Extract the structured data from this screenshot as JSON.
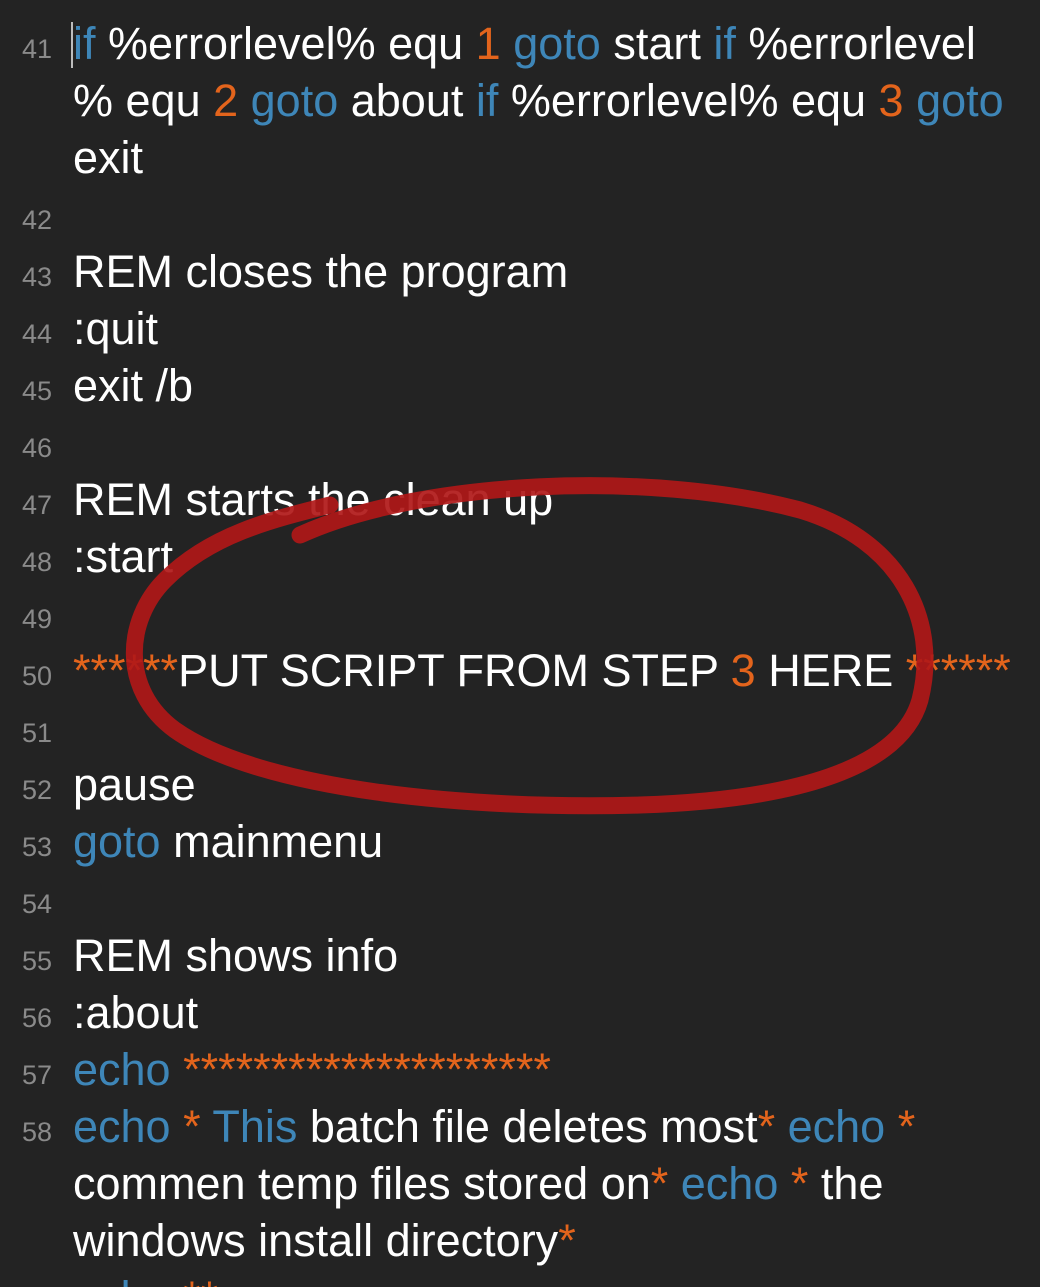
{
  "editor": {
    "lines": [
      {
        "n": "41",
        "segments": [
          [
            {
              "t": "if",
              "c": "kw"
            },
            {
              "t": " %errorlevel% equ ",
              "c": "str"
            },
            {
              "t": "1",
              "c": "num"
            },
            {
              "t": " ",
              "c": "str"
            },
            {
              "t": "goto",
              "c": "kw"
            },
            {
              "t": " start ",
              "c": "str"
            },
            {
              "t": "if",
              "c": "kw"
            },
            {
              "t": " %errorlevel",
              "c": "str"
            }
          ],
          [
            {
              "t": "% equ ",
              "c": "str"
            },
            {
              "t": "2",
              "c": "num"
            },
            {
              "t": " ",
              "c": "str"
            },
            {
              "t": "goto",
              "c": "kw"
            },
            {
              "t": " about ",
              "c": "str"
            },
            {
              "t": "if",
              "c": "kw"
            },
            {
              "t": " %errorlevel% equ ",
              "c": "str"
            },
            {
              "t": "3",
              "c": "num"
            },
            {
              "t": " ",
              "c": "str"
            },
            {
              "t": "goto",
              "c": "kw"
            }
          ],
          [
            {
              "t": "exit",
              "c": "str"
            }
          ]
        ]
      },
      {
        "n": "42",
        "segments": [
          []
        ]
      },
      {
        "n": "43",
        "segments": [
          [
            {
              "t": "REM closes the program",
              "c": "str"
            }
          ]
        ]
      },
      {
        "n": "44",
        "segments": [
          [
            {
              "t": ":quit",
              "c": "str"
            }
          ]
        ]
      },
      {
        "n": "45",
        "segments": [
          [
            {
              "t": "exit /b",
              "c": "str"
            }
          ]
        ]
      },
      {
        "n": "46",
        "segments": [
          []
        ]
      },
      {
        "n": "47",
        "segments": [
          [
            {
              "t": "REM starts the clean up",
              "c": "str"
            }
          ]
        ]
      },
      {
        "n": "48",
        "segments": [
          [
            {
              "t": ":start",
              "c": "str"
            }
          ]
        ]
      },
      {
        "n": "49",
        "segments": [
          []
        ]
      },
      {
        "n": "50",
        "segments": [
          [
            {
              "t": "******",
              "c": "num"
            },
            {
              "t": "PUT SCRIPT FROM STEP ",
              "c": "str"
            },
            {
              "t": "3",
              "c": "num"
            },
            {
              "t": " HERE ",
              "c": "str"
            },
            {
              "t": "******",
              "c": "num"
            }
          ]
        ]
      },
      {
        "n": "51",
        "segments": [
          []
        ]
      },
      {
        "n": "52",
        "segments": [
          [
            {
              "t": "pause",
              "c": "str"
            }
          ]
        ]
      },
      {
        "n": "53",
        "segments": [
          [
            {
              "t": "goto",
              "c": "kw"
            },
            {
              "t": " mainmenu",
              "c": "str"
            }
          ]
        ]
      },
      {
        "n": "54",
        "segments": [
          []
        ]
      },
      {
        "n": "55",
        "segments": [
          [
            {
              "t": "REM shows info",
              "c": "str"
            }
          ]
        ]
      },
      {
        "n": "56",
        "segments": [
          [
            {
              "t": ":about",
              "c": "str"
            }
          ]
        ]
      },
      {
        "n": "57",
        "segments": [
          [
            {
              "t": "echo",
              "c": "kw"
            },
            {
              "t": " ",
              "c": "str"
            },
            {
              "t": "*********************",
              "c": "num"
            }
          ]
        ]
      },
      {
        "n": "58",
        "segments": [
          [
            {
              "t": "echo",
              "c": "kw"
            },
            {
              "t": " ",
              "c": "str"
            },
            {
              "t": "*",
              "c": "num"
            },
            {
              "t": " ",
              "c": "str"
            },
            {
              "t": "This",
              "c": "kw"
            },
            {
              "t": " batch file deletes most",
              "c": "str"
            },
            {
              "t": "*",
              "c": "num"
            },
            {
              "t": " ",
              "c": "str"
            },
            {
              "t": "echo",
              "c": "kw"
            },
            {
              "t": " ",
              "c": "str"
            },
            {
              "t": "*",
              "c": "num"
            }
          ],
          [
            {
              "t": "commen temp files stored on",
              "c": "str"
            },
            {
              "t": "*",
              "c": "num"
            },
            {
              "t": " ",
              "c": "str"
            },
            {
              "t": "echo",
              "c": "kw"
            },
            {
              "t": " ",
              "c": "str"
            },
            {
              "t": "*",
              "c": "num"
            },
            {
              "t": " the",
              "c": "str"
            }
          ],
          [
            {
              "t": "windows install directory",
              "c": "str"
            },
            {
              "t": "*",
              "c": "num"
            }
          ]
        ]
      },
      {
        "n": "",
        "segments": [
          [
            {
              "t": "echo",
              "c": "kw"
            },
            {
              "t": " ",
              "c": "str"
            },
            {
              "t": "**",
              "c": "num"
            }
          ]
        ]
      }
    ]
  },
  "annotation": {
    "shape": "hand-drawn-circle",
    "color": "#b01818"
  }
}
